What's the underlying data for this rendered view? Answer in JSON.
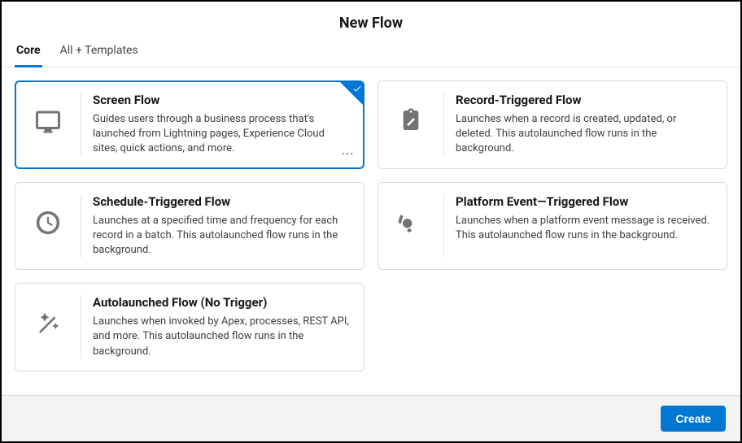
{
  "header": {
    "title": "New Flow"
  },
  "tabs": {
    "core": "Core",
    "templates": "All + Templates"
  },
  "cards": {
    "screen": {
      "title": "Screen Flow",
      "desc": "Guides users through a business process that's launched from Lightning pages, Experience Cloud sites, quick actions, and more."
    },
    "record": {
      "title": "Record-Triggered Flow",
      "desc": "Launches when a record is created, updated, or deleted. This autolaunched flow runs in the background."
    },
    "schedule": {
      "title": "Schedule-Triggered Flow",
      "desc": "Launches at a specified time and frequency for each record in a batch. This autolaunched flow runs in the background."
    },
    "platform": {
      "title": "Platform Event—Triggered Flow",
      "desc": "Launches when a platform event message is received. This autolaunched flow runs in the background."
    },
    "auto": {
      "title": "Autolaunched Flow (No Trigger)",
      "desc": "Launches when invoked by Apex, processes, REST API, and more. This autolaunched flow runs in the background."
    }
  },
  "footer": {
    "create": "Create"
  }
}
